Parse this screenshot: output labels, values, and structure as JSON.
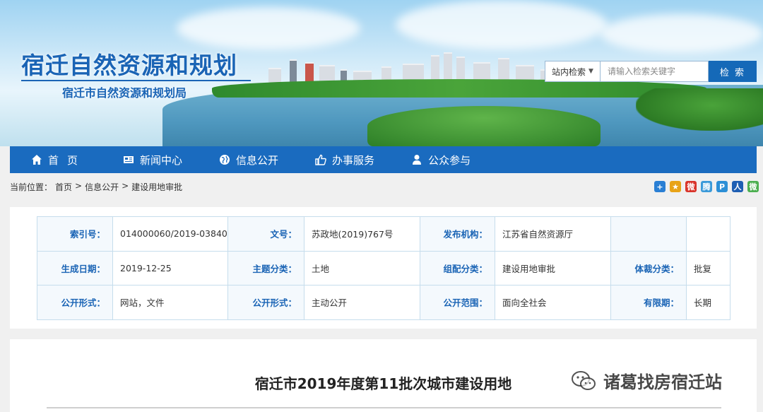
{
  "header": {
    "site_title": "宿迁自然资源和规划",
    "site_subtitle": "宿迁市自然资源和规划局",
    "search": {
      "scope_label": "站内检索",
      "placeholder": "请输入检索关键字",
      "button_label": "检 索"
    }
  },
  "nav": {
    "items": [
      {
        "label": "首页",
        "icon": "home-icon"
      },
      {
        "label": "新闻中心",
        "icon": "newspaper-icon"
      },
      {
        "label": "信息公开",
        "icon": "globe-icon"
      },
      {
        "label": "办事服务",
        "icon": "thumbs-up-icon"
      },
      {
        "label": "公众参与",
        "icon": "user-icon"
      }
    ]
  },
  "breadcrumb": {
    "prefix": "当前位置：",
    "items": [
      "首页",
      "信息公开",
      "建设用地审批"
    ],
    "separator": ">"
  },
  "share_icons": [
    {
      "name": "plus-share-icon",
      "glyph": "+",
      "color": "#2a7fd4"
    },
    {
      "name": "qzone-share-icon",
      "glyph": "★",
      "color": "#e8a317"
    },
    {
      "name": "weibo-share-icon",
      "glyph": "微",
      "color": "#d9342b"
    },
    {
      "name": "tencent-weibo-share-icon",
      "glyph": "腾",
      "color": "#3b9ad9"
    },
    {
      "name": "pengyou-share-icon",
      "glyph": "P",
      "color": "#2c8fd6"
    },
    {
      "name": "renren-share-icon",
      "glyph": "人",
      "color": "#1f5fb3"
    },
    {
      "name": "wechat-share-icon",
      "glyph": "微",
      "color": "#4caf50"
    }
  ],
  "info": {
    "rows": [
      [
        {
          "key": "索引号：",
          "value": "014000060/2019-03840"
        },
        {
          "key": "文号：",
          "value": "苏政地(2019)767号"
        },
        {
          "key": "发布机构：",
          "value": "江苏省自然资源厅"
        },
        {
          "key": "",
          "value": ""
        }
      ],
      [
        {
          "key": "生成日期：",
          "value": "2019-12-25"
        },
        {
          "key": "主题分类：",
          "value": "土地"
        },
        {
          "key": "组配分类：",
          "value": "建设用地审批"
        },
        {
          "key": "体裁分类：",
          "value": "批复"
        }
      ],
      [
        {
          "key": "公开形式：",
          "value": "网站，文件"
        },
        {
          "key": "公开形式：",
          "value": "主动公开"
        },
        {
          "key": "公开范围：",
          "value": "面向全社会"
        },
        {
          "key": "有限期：",
          "value": "长期"
        }
      ]
    ]
  },
  "article": {
    "title": "宿迁市2019年度第11批次城市建设用地"
  },
  "watermark": {
    "text": "诸葛找房宿迁站"
  },
  "colors": {
    "brand_blue": "#1a6bbf",
    "title_blue": "#1a64b5",
    "table_border": "#c6ddec"
  }
}
